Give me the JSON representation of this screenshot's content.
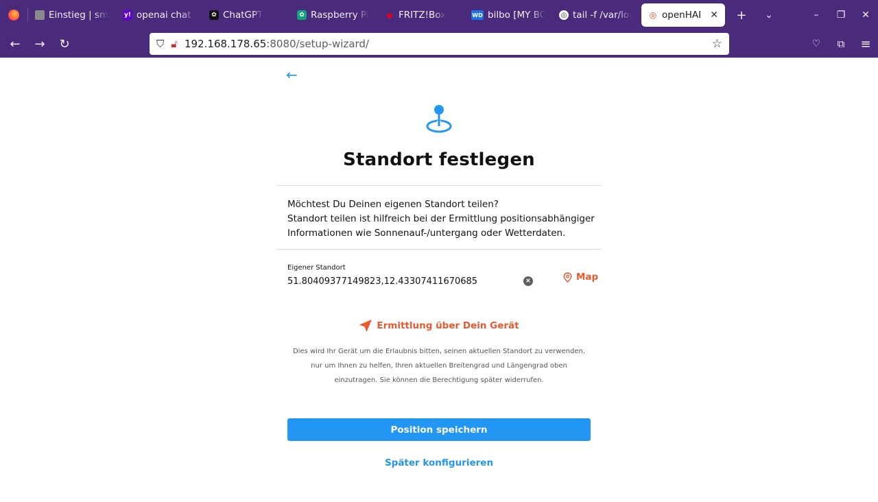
{
  "browser": {
    "tabs": [
      {
        "title": "Einstieg | smartHome",
        "icon": "generic-page-icon",
        "color": "#8a8a8a"
      },
      {
        "title": "openai chat gpt",
        "icon": "yahoo-icon",
        "color": "#6001d2"
      },
      {
        "title": "ChatGPT",
        "icon": "chatgpt-icon",
        "color": "#111111"
      },
      {
        "title": "Raspberry Pi",
        "icon": "chatgpt-icon",
        "color": "#10a37f"
      },
      {
        "title": "FRITZ!Box",
        "icon": "fritzbox-icon",
        "color": "#e2001a"
      },
      {
        "title": "bilbo [MY BOOK]",
        "icon": "wd-icon",
        "color": "#1a73e8"
      },
      {
        "title": "tail -f /var/log",
        "icon": "chatgpt-icon",
        "color": "#ffffff"
      },
      {
        "title": "openHAB",
        "icon": "openhab-icon",
        "color": "#e64a19"
      }
    ],
    "url_host": "192.168.178.65",
    "url_rest": ":8080/setup-wizard/"
  },
  "page": {
    "title": "Standort festlegen",
    "description_lines": [
      "Möchtest Du Deinen eigenen Standort teilen?",
      "Standort teilen ist hilfreich bei der Ermittlung positionsabhängiger",
      "Informationen wie Sonnenauf-/untergang oder Wetterdaten."
    ],
    "field_label": "Eigener Standort",
    "field_value": "51.80409377149823,12.43307411670685",
    "map_label": "Map",
    "locate_label": "Ermittlung über Dein Gerät",
    "hint_lines": [
      "Dies wird Ihr Gerät um die Erlaubnis bitten, seinen aktuellen Standort zu verwenden,",
      "nur um Ihnen zu helfen, Ihren aktuellen Breitengrad und Längengrad oben",
      "einzutragen. Sie können die Berechtigung später widerrufen."
    ],
    "save_label": "Position speichern",
    "later_label": "Später konfigurieren"
  },
  "colors": {
    "chrome": "#4a2a7a",
    "accent_blue": "#2196f3",
    "accent_orange": "#e8592f"
  }
}
